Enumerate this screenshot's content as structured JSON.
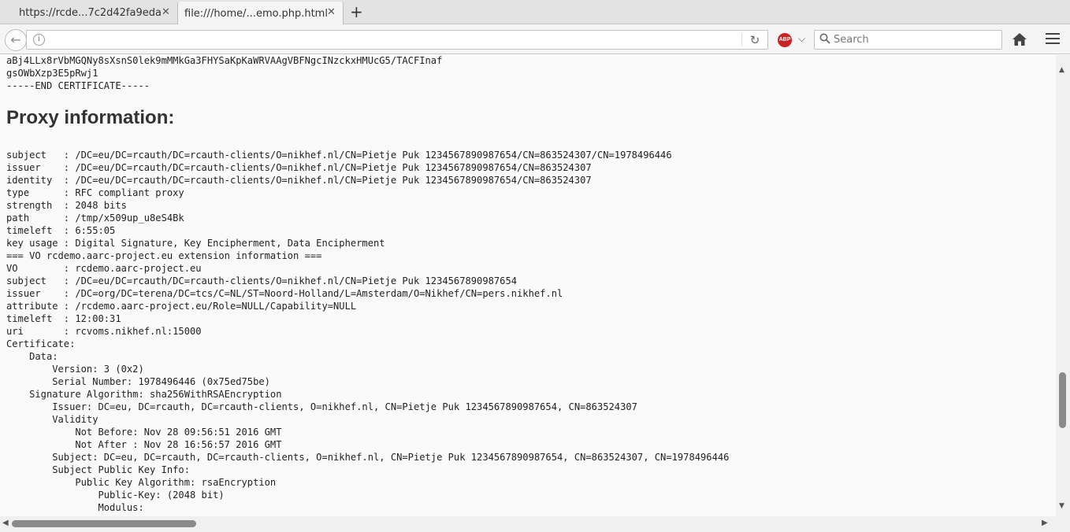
{
  "tabs": [
    {
      "title": "https://rcde...7c2d42fa9eda",
      "close": "✕"
    },
    {
      "title": "file:///home/...emo.php.html",
      "close": "✕"
    }
  ],
  "toolbar": {
    "new_tab": "+",
    "url_value": "",
    "search_placeholder": "Search",
    "abp_label": "ABP",
    "back": "←",
    "reload": "↻",
    "chevron": "⌵"
  },
  "page": {
    "top_text": "aBj4LLx8rVbMGQNy8sXsnS0lek9mMMkGa3FHYSaKpKaWRVAAgVBFNgcINzckxHMUcG5/TACFInaf\ngsOWbXzp3E5pRwj1\n-----END CERTIFICATE-----",
    "heading": "Proxy information:",
    "proxy_text": "subject   : /DC=eu/DC=rcauth/DC=rcauth-clients/O=nikhef.nl/CN=Pietje Puk 1234567890987654/CN=863524307/CN=1978496446\nissuer    : /DC=eu/DC=rcauth/DC=rcauth-clients/O=nikhef.nl/CN=Pietje Puk 1234567890987654/CN=863524307\nidentity  : /DC=eu/DC=rcauth/DC=rcauth-clients/O=nikhef.nl/CN=Pietje Puk 1234567890987654/CN=863524307\ntype      : RFC compliant proxy\nstrength  : 2048 bits\npath      : /tmp/x509up_u8eS4Bk\ntimeleft  : 6:55:05\nkey usage : Digital Signature, Key Encipherment, Data Encipherment\n=== VO rcdemo.aarc-project.eu extension information ===\nVO        : rcdemo.aarc-project.eu\nsubject   : /DC=eu/DC=rcauth/DC=rcauth-clients/O=nikhef.nl/CN=Pietje Puk 1234567890987654\nissuer    : /DC=org/DC=terena/DC=tcs/C=NL/ST=Noord-Holland/L=Amsterdam/O=Nikhef/CN=pers.nikhef.nl\nattribute : /rcdemo.aarc-project.eu/Role=NULL/Capability=NULL\ntimeleft  : 12:00:31\nuri       : rcvoms.nikhef.nl:15000\nCertificate:\n    Data:\n        Version: 3 (0x2)\n        Serial Number: 1978496446 (0x75ed75be)\n    Signature Algorithm: sha256WithRSAEncryption\n        Issuer: DC=eu, DC=rcauth, DC=rcauth-clients, O=nikhef.nl, CN=Pietje Puk 1234567890987654, CN=863524307\n        Validity\n            Not Before: Nov 28 09:56:51 2016 GMT\n            Not After : Nov 28 16:56:57 2016 GMT\n        Subject: DC=eu, DC=rcauth, DC=rcauth-clients, O=nikhef.nl, CN=Pietje Puk 1234567890987654, CN=863524307, CN=1978496446\n        Subject Public Key Info:\n            Public Key Algorithm: rsaEncryption\n                Public-Key: (2048 bit)\n                Modulus:"
  },
  "scroll": {
    "vertical_fraction": 0.72,
    "horizontal_fraction": 0.0
  },
  "colors": {
    "abp_red": "#cc2222",
    "scroll_thumb": "#8a8a8a"
  }
}
